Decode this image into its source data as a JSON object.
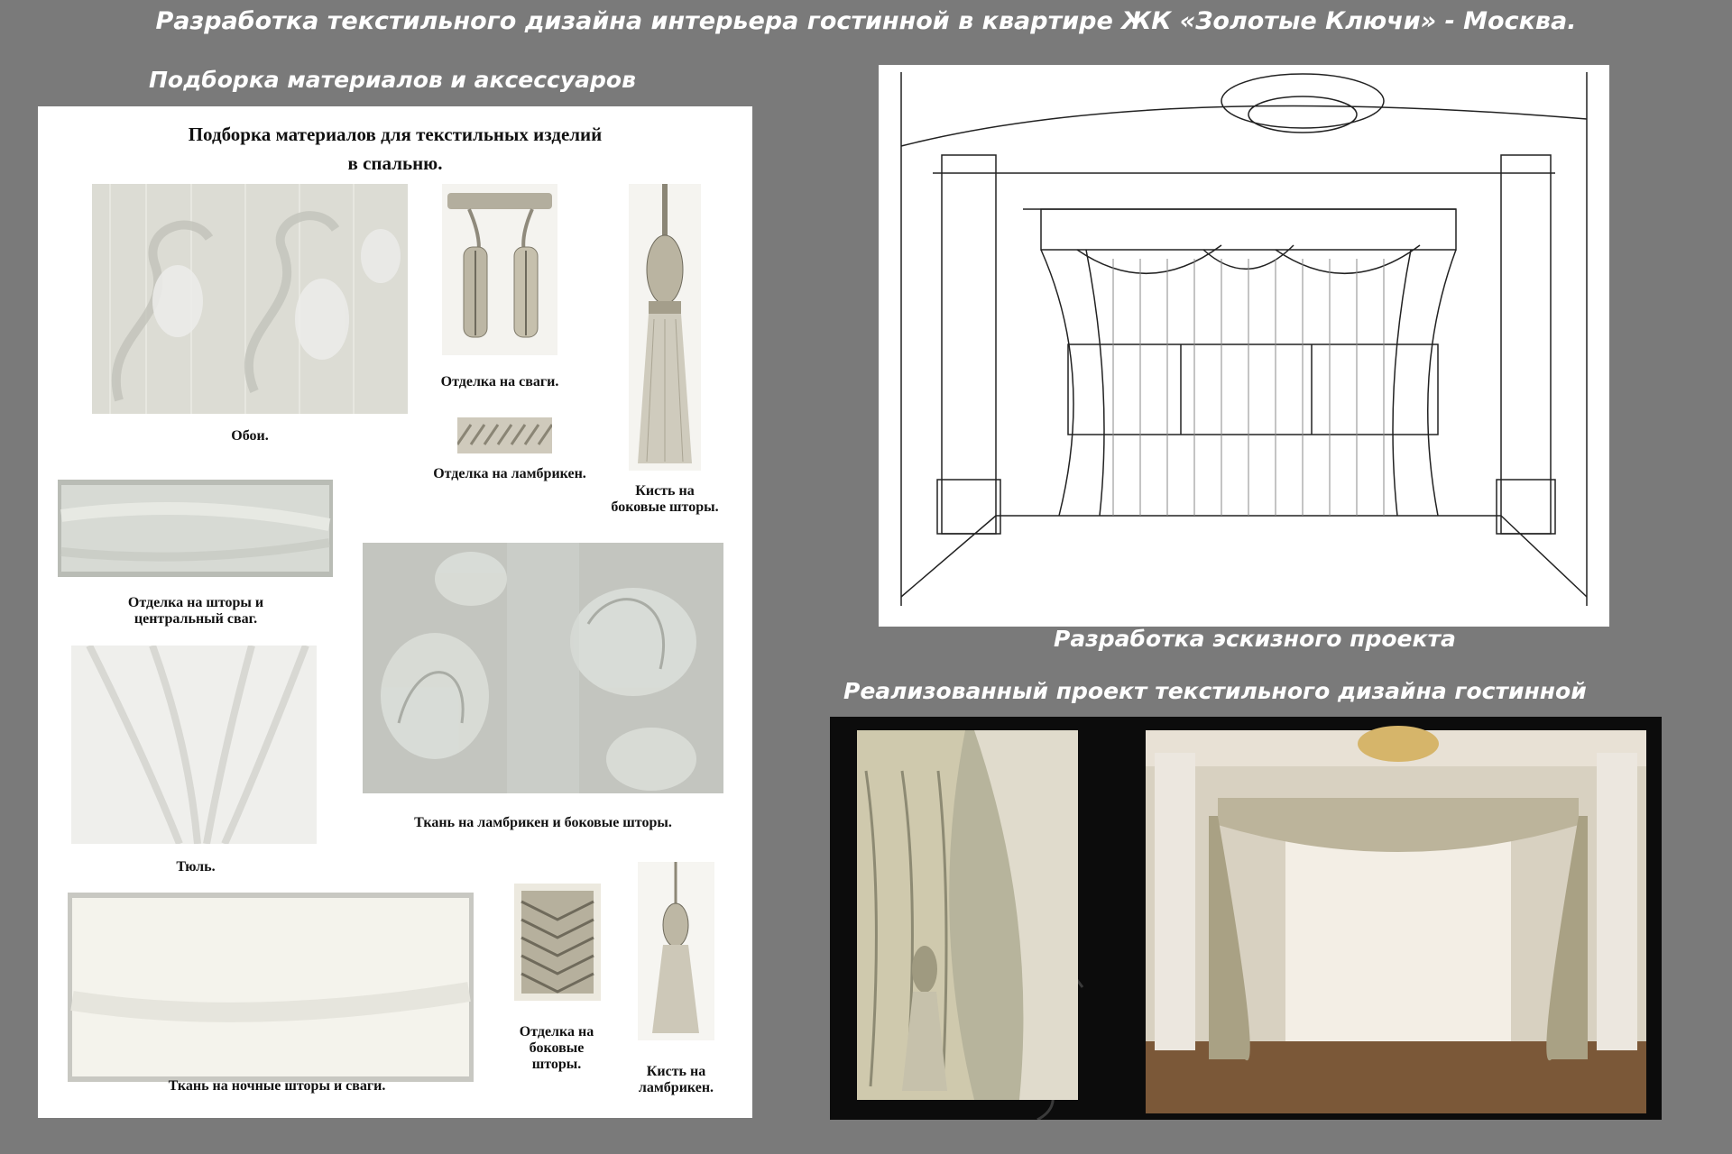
{
  "page": {
    "title": "Разработка текстильного дизайна интерьера гостинной в квартире ЖК «Золотые Ключи» - Москва.",
    "left_heading": "Подборка материалов и аксессуаров",
    "sketch_caption": "Разработка эскизного проекта",
    "photo_heading": "Реализованный проект текстильного дизайна гостинной"
  },
  "board": {
    "title_line1": "Подборка материалов для текстильных изделий",
    "title_line2": "в спальню.",
    "items": [
      {
        "id": "wallpaper",
        "caption": [
          "Обои."
        ]
      },
      {
        "id": "swag-trim",
        "caption": [
          "Отделка на сваги."
        ]
      },
      {
        "id": "lambrequin-trim",
        "caption": [
          "Отделка на ламбрикен."
        ]
      },
      {
        "id": "side-tassel",
        "caption": [
          "Кисть на",
          "боковые шторы."
        ]
      },
      {
        "id": "curtain-trim",
        "caption": [
          "Отделка на шторы и",
          "центральный сваг."
        ]
      },
      {
        "id": "lambrequin-fabric",
        "caption": [
          "Ткань на ламбрикен и боковые шторы."
        ]
      },
      {
        "id": "tulle",
        "caption": [
          "Тюль."
        ]
      },
      {
        "id": "night-fabric",
        "caption": [
          "Ткань на ночные шторы и сваги."
        ]
      },
      {
        "id": "side-trim",
        "caption": [
          "Отделка на",
          "боковые",
          "шторы."
        ]
      },
      {
        "id": "lambrequin-tassel",
        "caption": [
          "Кисть на",
          "ламбрикен."
        ]
      }
    ]
  },
  "colors": {
    "background": "#7a7a7a",
    "heading": "#ffffff",
    "board": "#ffffff",
    "fabric_silver": "#d6d6cf",
    "fabric_gold": "#c9bfa6"
  }
}
